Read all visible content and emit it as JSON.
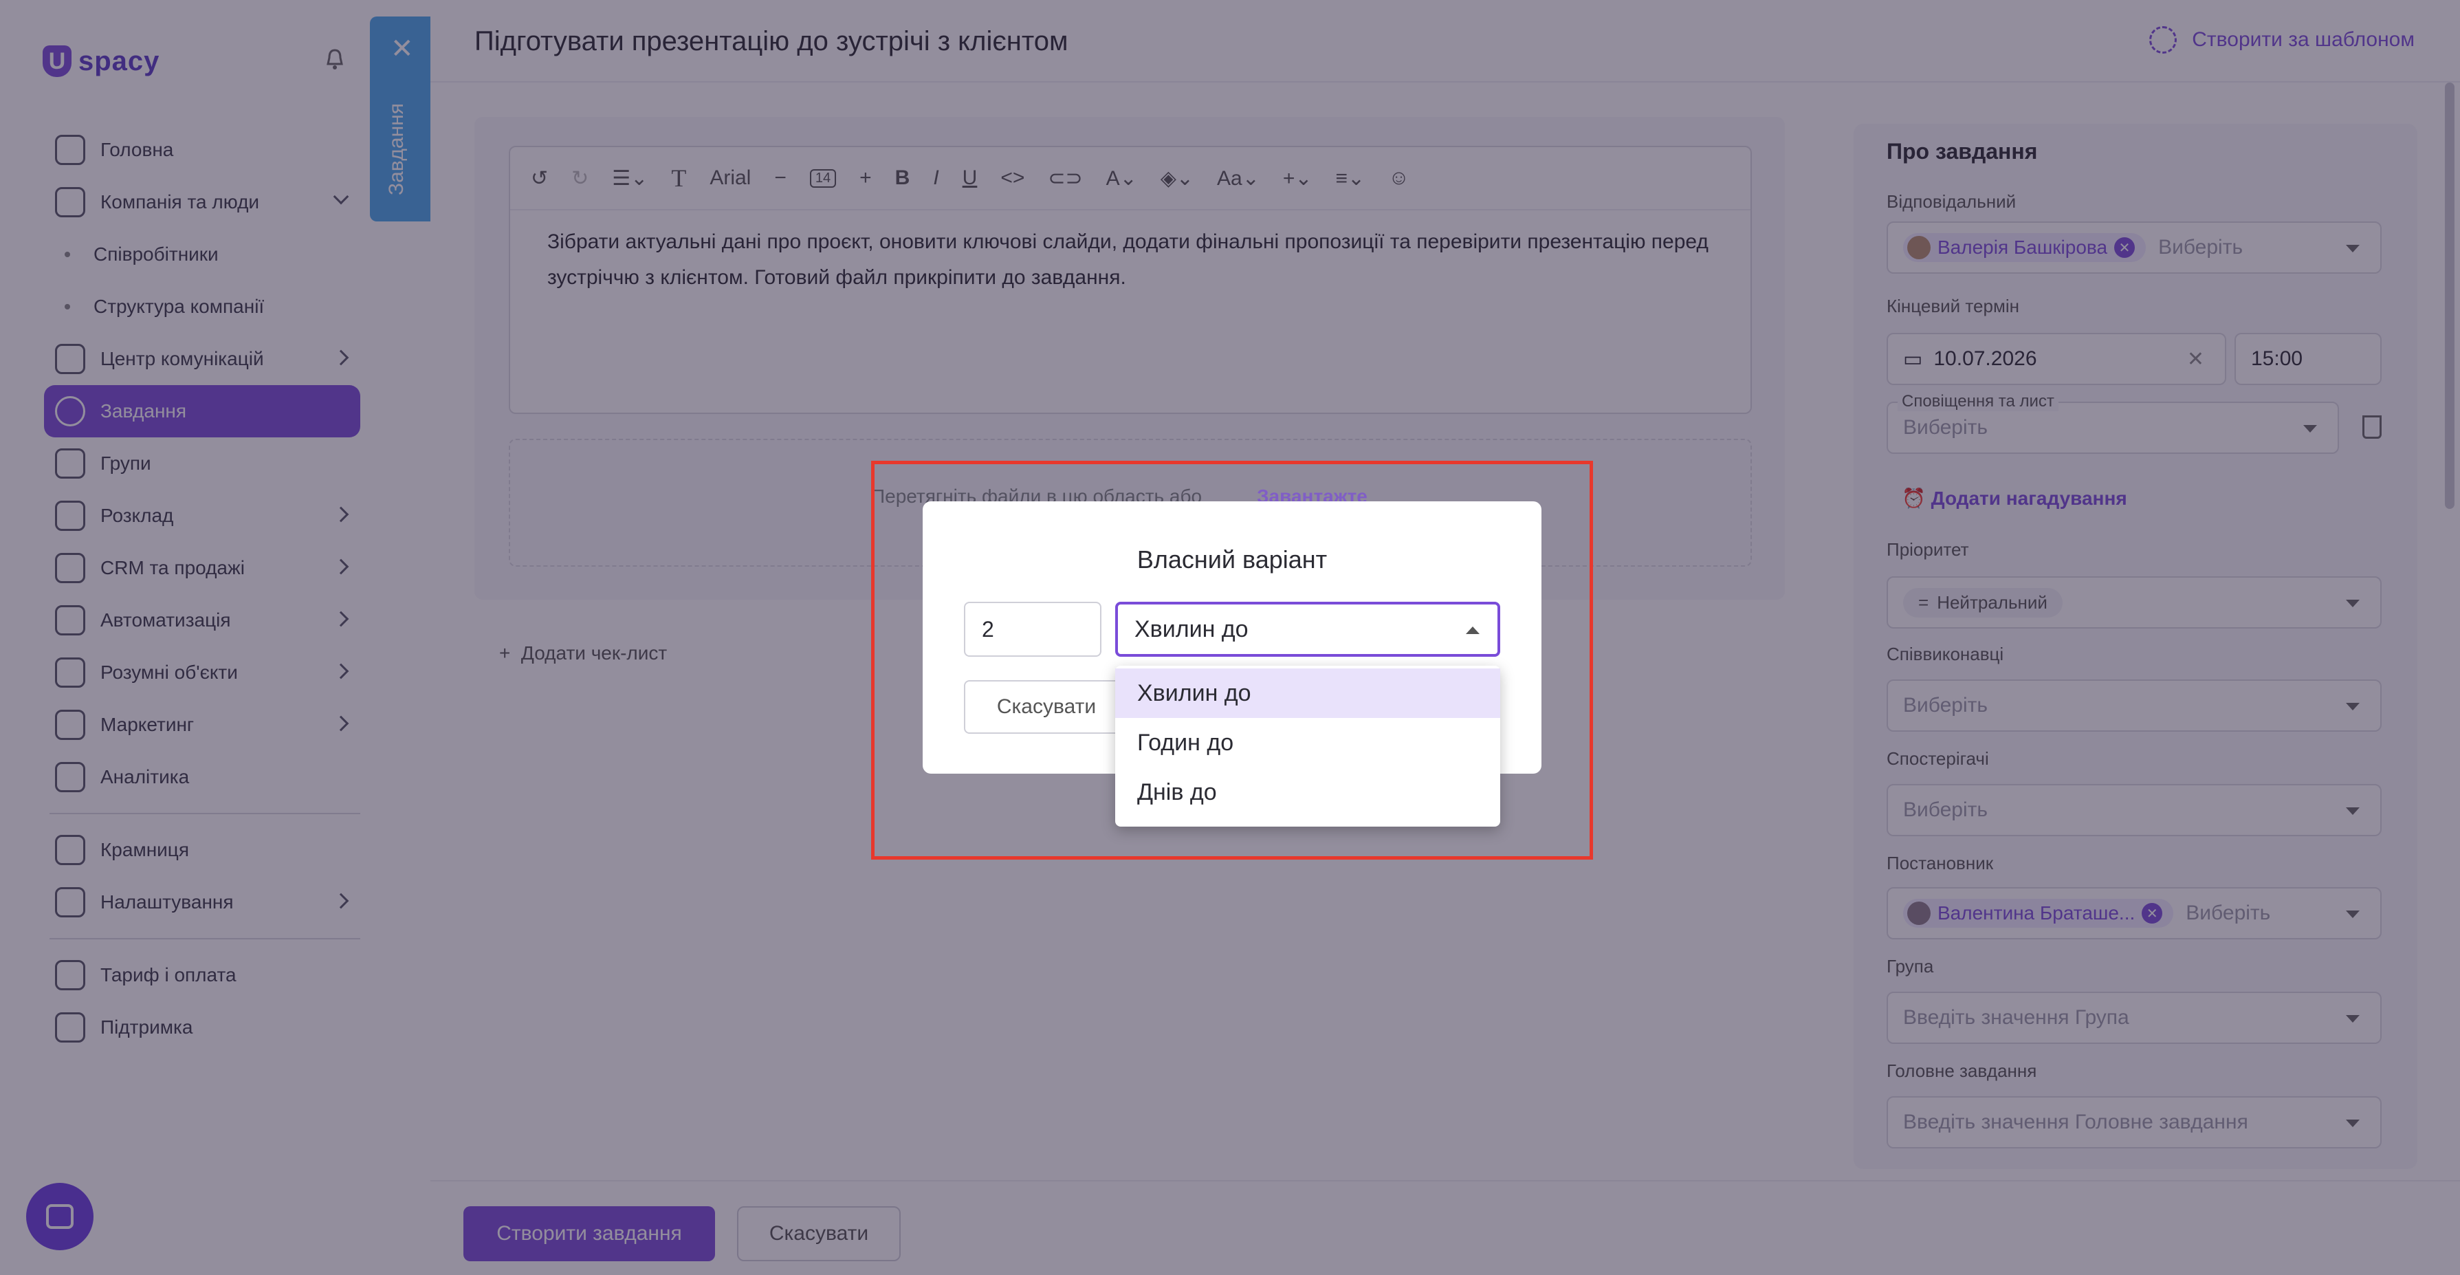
{
  "sidebar": {
    "logo": "spacy",
    "nav": {
      "home": "Головна",
      "company": "Компанія та люди",
      "employees": "Співробітники",
      "structure": "Структура компанії",
      "communications": "Центр комунікацій",
      "tasks": "Завдання",
      "groups": "Групи",
      "schedule": "Розклад",
      "crm": "CRM та продажі",
      "automation": "Автоматизація",
      "smart_objects": "Розумні об'єкти",
      "marketing": "Маркетинг",
      "analytics": "Аналітика",
      "store": "Крамниця",
      "settings": "Налаштування",
      "tariff": "Тариф і оплата",
      "support": "Підтримка"
    },
    "task_tab_label": "Завдання"
  },
  "header": {
    "title": "Підготувати презентацію до зустрічі з клієнтом",
    "template_link": "Створити за шаблоном"
  },
  "editor": {
    "font": "Arial",
    "font_size": "14",
    "text": "Зібрати актуальні дані про проєкт, оновити ключові слайди, додати фінальні пропозиції та перевірити презентацію перед зустріччю з клієнтом. Готовий файл прикріпити до завдання.",
    "dropzone_text": "Перетягніть файли в цю область або",
    "dropzone_link": "Завантажте",
    "add_checklist": "Додати чек-лист"
  },
  "details": {
    "title": "Про завдання",
    "responsible_label": "Відповідальний",
    "responsible_chip": "Валерія Башкірова",
    "select_placeholder": "Виберіть",
    "deadline_label": "Кінцевий термін",
    "deadline_date": "10.07.2026",
    "deadline_time": "15:00",
    "notify_label": "Сповіщення та лист",
    "add_reminder": "Додати нагадування",
    "priority_label": "Пріоритет",
    "priority_value": "Нейтральний",
    "coexecutors_label": "Співвиконавці",
    "observers_label": "Спостерігачі",
    "author_label": "Постановник",
    "author_chip": "Валентина Браташе...",
    "group_label": "Група",
    "group_placeholder": "Введіть значення Група",
    "parent_label": "Головне завдання",
    "parent_placeholder": "Введіть значення Головне завдання"
  },
  "footer": {
    "create": "Створити завдання",
    "cancel": "Скасувати"
  },
  "modal": {
    "title": "Власний варіант",
    "number": "2",
    "selected": "Хвилин до",
    "cancel": "Скасувати",
    "options": [
      "Хвилин до",
      "Годин до",
      "Днів до"
    ]
  },
  "colors": {
    "accent": "#7a4cd9",
    "highlight": "#e8382c",
    "task_tab": "#4aa6ea"
  }
}
